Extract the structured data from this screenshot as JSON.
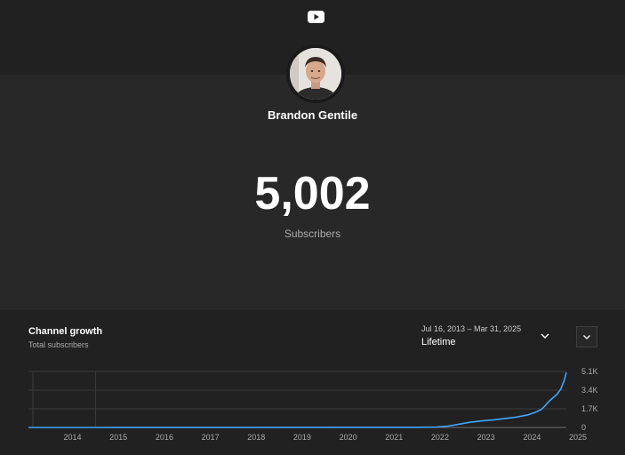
{
  "header": {
    "logo_icon": "youtube-play-icon",
    "channel_name": "Brandon Gentile"
  },
  "stats": {
    "subscriber_count": "5,002",
    "subscriber_label": "Subscribers"
  },
  "growth": {
    "title": "Channel growth",
    "subtitle": "Total subscribers",
    "date_range": "Jul 16, 2013 – Mar 31, 2025",
    "range_label": "Lifetime",
    "dropdown_icon": "chevron-down-icon",
    "menu_icon": "chevron-down-icon"
  },
  "colors": {
    "line": "#3ea6ff",
    "background": "#282828",
    "panel": "#212121"
  },
  "chart_data": {
    "type": "line",
    "title": "Channel growth",
    "subtitle": "Total subscribers",
    "xlabel": "",
    "ylabel": "",
    "x_ticks": [
      "2014",
      "2015",
      "2016",
      "2017",
      "2018",
      "2019",
      "2020",
      "2021",
      "2022",
      "2023",
      "2024",
      "2025"
    ],
    "y_ticks": [
      "0",
      "1.7K",
      "3.4K",
      "5.1K"
    ],
    "y_tick_values": [
      0,
      1700,
      3400,
      5100
    ],
    "ylim": [
      0,
      5100
    ],
    "xlim": [
      "2013-07-16",
      "2025-03-31"
    ],
    "grid": true,
    "series": [
      {
        "x": [
          "2013-07-16",
          "2015-01-01",
          "2018-01-01",
          "2022-01-01",
          "2022-06-01",
          "2022-09-01",
          "2022-12-01",
          "2023-03-01",
          "2023-06-01",
          "2023-09-01",
          "2023-12-01",
          "2024-03-01",
          "2024-06-01",
          "2024-08-01",
          "2024-09-15",
          "2024-10-15",
          "2024-11-15",
          "2024-12-15",
          "2025-01-15",
          "2025-02-15",
          "2025-03-15",
          "2025-03-31"
        ],
        "y": [
          0,
          2,
          8,
          20,
          40,
          120,
          300,
          480,
          600,
          700,
          820,
          950,
          1150,
          1400,
          1650,
          2000,
          2400,
          2700,
          3000,
          3500,
          4300,
          5002
        ]
      }
    ]
  }
}
